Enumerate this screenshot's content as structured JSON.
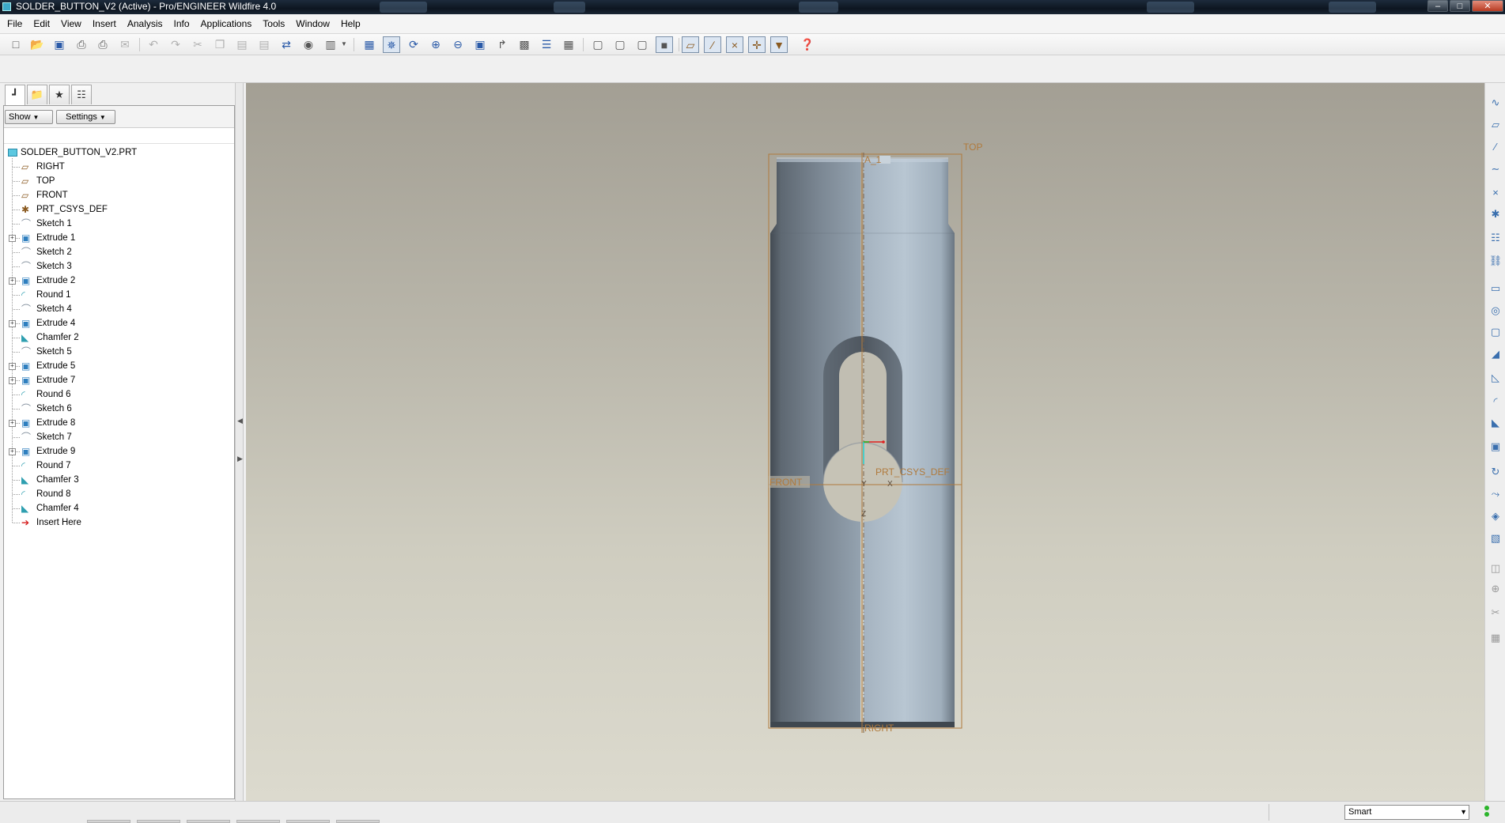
{
  "window": {
    "title": "SOLDER_BUTTON_V2 (Active) - Pro/ENGINEER Wildfire 4.0",
    "controls": [
      "minimize",
      "maximize",
      "close"
    ]
  },
  "menubar": [
    "File",
    "Edit",
    "View",
    "Insert",
    "Analysis",
    "Info",
    "Applications",
    "Tools",
    "Window",
    "Help"
  ],
  "toolbar": {
    "icons": [
      "new-icon",
      "open-icon",
      "save-icon",
      "print-icon",
      "print-preview-icon",
      "send-mail-icon",
      "undo-icon",
      "redo-icon",
      "cut-icon",
      "copy-icon",
      "paste-icon",
      "paste-special-icon",
      "regenerate-icon",
      "find-icon",
      "select-box-icon",
      "repaint-icon",
      "spin-center-icon",
      "orient-mode-icon",
      "zoom-in-icon",
      "zoom-out-icon",
      "refit-icon",
      "reorient-icon",
      "saved-views-icon",
      "layers-icon",
      "view-manager-icon",
      "wireframe-icon",
      "hidden-line-icon",
      "no-hidden-icon",
      "shading-icon",
      "datum-planes-icon",
      "datum-axes-icon",
      "datum-points-icon",
      "csys-icon",
      "annotations-icon",
      "context-help-icon"
    ]
  },
  "navigator": {
    "tabs": [
      "model-tree-tab",
      "folder-browser-tab",
      "favorites-tab",
      "connections-tab"
    ],
    "show_button": "Show",
    "settings_button": "Settings",
    "tree_root": "SOLDER_BUTTON_V2.PRT",
    "tree_items": [
      {
        "label": "RIGHT",
        "kind": "datum-plane",
        "expandable": false
      },
      {
        "label": "TOP",
        "kind": "datum-plane",
        "expandable": false
      },
      {
        "label": "FRONT",
        "kind": "datum-plane",
        "expandable": false
      },
      {
        "label": "PRT_CSYS_DEF",
        "kind": "csys",
        "expandable": false
      },
      {
        "label": "Sketch 1",
        "kind": "sketch",
        "expandable": false
      },
      {
        "label": "Extrude 1",
        "kind": "extrude",
        "expandable": true
      },
      {
        "label": "Sketch 2",
        "kind": "sketch",
        "expandable": false
      },
      {
        "label": "Sketch 3",
        "kind": "sketch",
        "expandable": false
      },
      {
        "label": "Extrude 2",
        "kind": "extrude",
        "expandable": true
      },
      {
        "label": "Round 1",
        "kind": "round",
        "expandable": false
      },
      {
        "label": "Sketch 4",
        "kind": "sketch",
        "expandable": false
      },
      {
        "label": "Extrude 4",
        "kind": "extrude",
        "expandable": true
      },
      {
        "label": "Chamfer 2",
        "kind": "chamfer",
        "expandable": false
      },
      {
        "label": "Sketch 5",
        "kind": "sketch",
        "expandable": false
      },
      {
        "label": "Extrude 5",
        "kind": "extrude",
        "expandable": true
      },
      {
        "label": "Extrude 7",
        "kind": "extrude",
        "expandable": true
      },
      {
        "label": "Round 6",
        "kind": "round",
        "expandable": false
      },
      {
        "label": "Sketch 6",
        "kind": "sketch",
        "expandable": false
      },
      {
        "label": "Extrude 8",
        "kind": "extrude",
        "expandable": true
      },
      {
        "label": "Sketch 7",
        "kind": "sketch",
        "expandable": false
      },
      {
        "label": "Extrude 9",
        "kind": "extrude",
        "expandable": true
      },
      {
        "label": "Round 7",
        "kind": "round",
        "expandable": false
      },
      {
        "label": "Chamfer 3",
        "kind": "chamfer",
        "expandable": false
      },
      {
        "label": "Round 8",
        "kind": "round",
        "expandable": false
      },
      {
        "label": "Chamfer 4",
        "kind": "chamfer",
        "expandable": false
      },
      {
        "label": "Insert Here",
        "kind": "insert-here",
        "expandable": false
      }
    ]
  },
  "graphics": {
    "datum_labels": {
      "top": "TOP",
      "axis": "A_1",
      "front": "FRONT",
      "csys": "PRT_CSYS_DEF",
      "right": "RIGHT",
      "x_axis": "X",
      "y_axis": "Y",
      "z_axis": "Z"
    },
    "colors": {
      "datum": "#b07a3c",
      "model_dark": "#6d7a86",
      "model_light": "#b3c2cf"
    }
  },
  "right_toolbar": {
    "icons": [
      "sketch-tool-icon",
      "datum-plane-tool-icon",
      "datum-axis-tool-icon",
      "datum-curve-tool-icon",
      "datum-point-tool-icon",
      "csys-tool-icon",
      "analysis-tool-icon",
      "publish-geometry-icon",
      "feature-interface-icon",
      "hole-tool-icon",
      "shell-tool-icon",
      "rib-tool-icon",
      "draft-tool-icon",
      "round-tool-icon",
      "chamfer-tool-icon",
      "extrude-tool-icon",
      "revolve-tool-icon",
      "sweep-tool-icon",
      "blend-tool-icon",
      "boundary-blend-icon",
      "mirror-tool-icon",
      "merge-tool-icon",
      "trim-tool-icon",
      "pattern-tool-icon"
    ]
  },
  "statusbar": {
    "filter_value": "Smart"
  }
}
